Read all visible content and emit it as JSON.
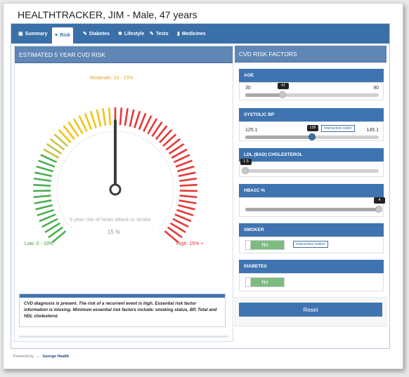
{
  "page": {
    "title": "HEALTHTRACKER, JIM - Male, 47 years"
  },
  "tabs": [
    {
      "label": "Summary",
      "icon": "clipboard-icon",
      "active": false
    },
    {
      "label": "Risk",
      "icon": "heart-icon",
      "active": true
    },
    {
      "label": "Diabetes",
      "icon": "pencil-icon",
      "active": false
    },
    {
      "label": "Lifestyle",
      "icon": "runner-icon",
      "active": false
    },
    {
      "label": "Tests",
      "icon": "pencil-icon",
      "active": false
    },
    {
      "label": "Medicines",
      "icon": "pill-icon",
      "active": false
    }
  ],
  "risk_panel": {
    "heading": "ESTIMATED 5 YEAR CVD RISK",
    "moderate_label": "Moderate: 10 - 15%",
    "low_label": "Low: 0 - 10%",
    "high_label": "High: 15% +",
    "gauge_caption": "5 year risk of heart attack or stroke",
    "gauge_value": "15 %",
    "gauge_percent": 15,
    "colors": {
      "low": "#4caf50",
      "moderate": "#f0c419",
      "high": "#e53935",
      "moderate_text": "#e8a33a"
    }
  },
  "diagnosis": {
    "text": "CVD diagnosis is present. The risk of a recurrent event is high. Essential risk factor information is missing. Minimum essential risk factors include: smoking status, BP, Total and HDL cholesterol."
  },
  "factors_panel": {
    "heading": "CVD RISK FACTORS",
    "age": {
      "label": "AGE",
      "min": "30",
      "max": "90",
      "value": "47",
      "fraction": 0.28
    },
    "systolic": {
      "label": "SYSTOLIC BP",
      "min": "125.1",
      "max": "145.1",
      "value": "135",
      "fraction": 0.5,
      "tooltip": "Interactive slider"
    },
    "ldl": {
      "label": "LDL (BAD) CHOLESTEROL",
      "value": "1.5",
      "fraction": 0.0
    },
    "hba1c": {
      "label": "HBA1C %",
      "value": "4",
      "fraction": 1.0
    },
    "smoker": {
      "label": "SMOKER",
      "value": "No",
      "tooltip": "Interactive button"
    },
    "diabetes": {
      "label": "DIABETES",
      "value": "No"
    },
    "reset_label": "Reset"
  },
  "footer": {
    "powered_by": "Powered by",
    "brand": "George Health"
  }
}
